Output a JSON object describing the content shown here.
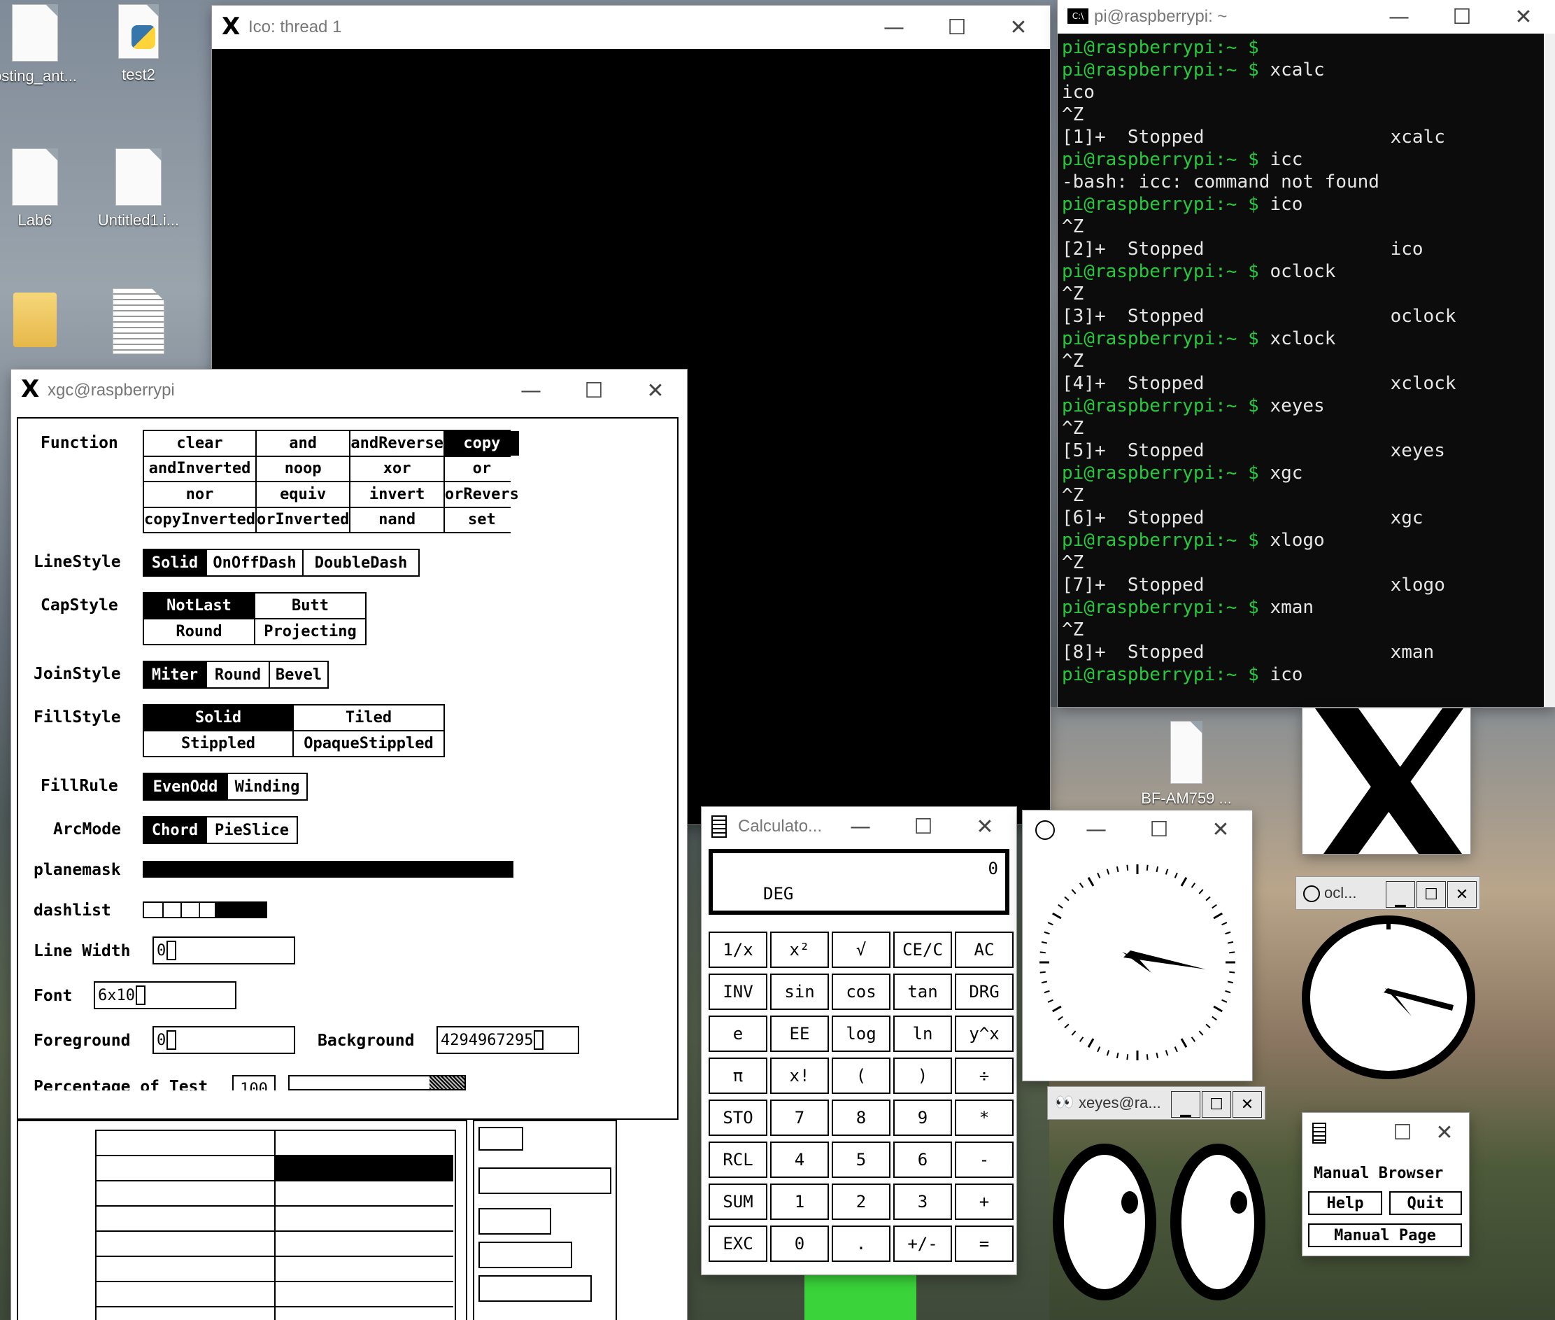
{
  "desktop": {
    "icons": [
      {
        "label": "osting_ant..."
      },
      {
        "label": "test2"
      },
      {
        "label": "Lab6"
      },
      {
        "label": "Untitled1.i..."
      },
      {
        "label": "BF-AM759 ..."
      }
    ]
  },
  "ico_window": {
    "title": "Ico: thread 1"
  },
  "terminal": {
    "title": "pi@raspberrypi: ~",
    "prompt_user": "pi@raspberrypi",
    "prompt_suffix": ":~ $ ",
    "lines": [
      {
        "type": "prompt",
        "cmd": ""
      },
      {
        "type": "prompt",
        "cmd": "xcalc"
      },
      {
        "type": "out",
        "text": "ico"
      },
      {
        "type": "out",
        "text": "^Z"
      },
      {
        "type": "out",
        "text": "[1]+  Stopped                 xcalc"
      },
      {
        "type": "prompt",
        "cmd": "icc"
      },
      {
        "type": "out",
        "text": "-bash: icc: command not found"
      },
      {
        "type": "prompt",
        "cmd": "ico"
      },
      {
        "type": "out",
        "text": "^Z"
      },
      {
        "type": "out",
        "text": "[2]+  Stopped                 ico"
      },
      {
        "type": "prompt",
        "cmd": "oclock"
      },
      {
        "type": "out",
        "text": "^Z"
      },
      {
        "type": "out",
        "text": "[3]+  Stopped                 oclock"
      },
      {
        "type": "prompt",
        "cmd": "xclock"
      },
      {
        "type": "out",
        "text": "^Z"
      },
      {
        "type": "out",
        "text": "[4]+  Stopped                 xclock"
      },
      {
        "type": "prompt",
        "cmd": "xeyes"
      },
      {
        "type": "out",
        "text": "^Z"
      },
      {
        "type": "out",
        "text": "[5]+  Stopped                 xeyes"
      },
      {
        "type": "prompt",
        "cmd": "xgc"
      },
      {
        "type": "out",
        "text": "^Z"
      },
      {
        "type": "out",
        "text": "[6]+  Stopped                 xgc"
      },
      {
        "type": "prompt",
        "cmd": "xlogo"
      },
      {
        "type": "out",
        "text": "^Z"
      },
      {
        "type": "out",
        "text": "[7]+  Stopped                 xlogo"
      },
      {
        "type": "prompt",
        "cmd": "xman"
      },
      {
        "type": "out",
        "text": "^Z"
      },
      {
        "type": "out",
        "text": "[8]+  Stopped                 xman"
      },
      {
        "type": "prompt",
        "cmd": "ico"
      }
    ]
  },
  "xgc": {
    "title": "xgc@raspberrypi",
    "function_label": "Function",
    "functions": [
      "clear",
      "and",
      "andReverse",
      "copy",
      "andInverted",
      "noop",
      "xor",
      "or",
      "nor",
      "equiv",
      "invert",
      "orRevers",
      "copyInverted",
      "orInverted",
      "nand",
      "set"
    ],
    "function_selected": "copy",
    "linestyle_label": "LineStyle",
    "linestyles": [
      "Solid",
      "OnOffDash",
      "DoubleDash"
    ],
    "capstyle_label": "CapStyle",
    "capstyles": [
      "NotLast",
      "Butt",
      "Round",
      "Projecting"
    ],
    "joinstyle_label": "JoinStyle",
    "joinstyles": [
      "Miter",
      "Round",
      "Bevel"
    ],
    "fillstyle_label": "FillStyle",
    "fillstyles": [
      "Solid",
      "Tiled",
      "Stippled",
      "OpaqueStippled"
    ],
    "fillrule_label": "FillRule",
    "fillrules": [
      "EvenOdd",
      "Winding"
    ],
    "arcmode_label": "ArcMode",
    "arcmodes": [
      "Chord",
      "PieSlice"
    ],
    "planemask_label": "planemask",
    "dashlist_label": "dashlist",
    "linewidth_label": "Line Width",
    "linewidth_value": "0",
    "font_label": "Font",
    "font_value": "6x10",
    "foreground_label": "Foreground",
    "foreground_value": "0",
    "background_label": "Background",
    "background_value": "4294967295",
    "percentage_label": "Percentage of Test",
    "percentage_value": "100"
  },
  "calculator": {
    "title": "Calculato...",
    "display_value": "0",
    "mode": "DEG",
    "buttons": [
      [
        "1/x",
        "x²",
        "√",
        "CE/C",
        "AC"
      ],
      [
        "INV",
        "sin",
        "cos",
        "tan",
        "DRG"
      ],
      [
        "e",
        "EE",
        "log",
        "ln",
        "y^x"
      ],
      [
        "π",
        "x!",
        "(",
        ")",
        "÷"
      ],
      [
        "STO",
        "7",
        "8",
        "9",
        "*"
      ],
      [
        "RCL",
        "4",
        "5",
        "6",
        "-"
      ],
      [
        "SUM",
        "1",
        "2",
        "3",
        "+"
      ],
      [
        "EXC",
        "0",
        ".",
        "+/-",
        "="
      ]
    ]
  },
  "oclock": {
    "title": "ocl..."
  },
  "xeyes": {
    "title": "xeyes@ra..."
  },
  "xman": {
    "heading": "Manual Browser",
    "help": "Help",
    "quit": "Quit",
    "manual_page": "Manual Page"
  }
}
